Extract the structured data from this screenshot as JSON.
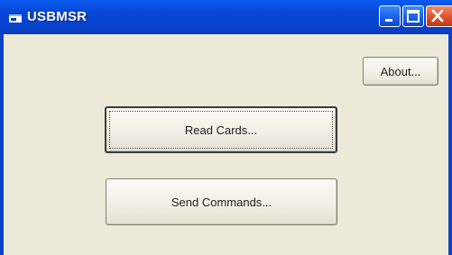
{
  "window": {
    "title": "USBMSR",
    "icon": "app-window-icon"
  },
  "caption_buttons": [
    "minimize-icon",
    "maximize-icon",
    "close-icon"
  ],
  "buttons": {
    "about": "About...",
    "read_cards": "Read Cards...",
    "send_commands": "Send Commands..."
  },
  "colors": {
    "titlebar": "#0747d6",
    "client": "#ece9d8",
    "close_button": "#e0502c"
  }
}
